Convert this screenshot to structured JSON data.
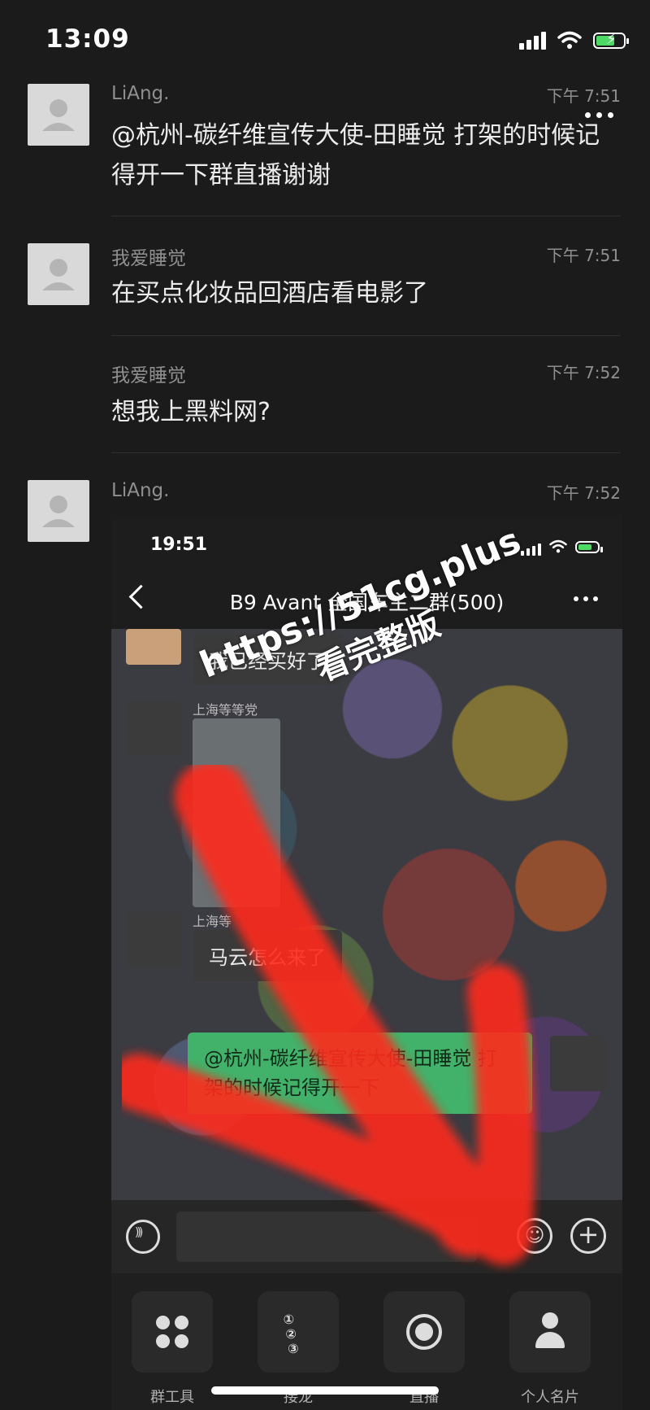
{
  "status_bar": {
    "time": "13:09"
  },
  "messages": [
    {
      "sender": "LiAng.",
      "time": "下午 7:51",
      "text": "@杭州-碳纤维宣传大使-田睡觉 打架的时候记得开一下群直播谢谢"
    },
    {
      "sender": "我爱睡觉",
      "time": "下午 7:51",
      "text": "在买点化妆品回酒店看电影了"
    },
    {
      "sender": "我爱睡觉",
      "time": "下午 7:52",
      "text": "想我上黑料网?"
    },
    {
      "sender": "LiAng.",
      "time": "下午 7:52",
      "text": ""
    }
  ],
  "embedded_screenshot": {
    "time": "19:51",
    "title": "B9 Avant 全国车主二群(500)",
    "chat": [
      {
        "name": "",
        "text": "我已经买好了"
      },
      {
        "name": "上海等等党",
        "text": ""
      },
      {
        "name": "上海等",
        "text": "马云怎么来了"
      },
      {
        "name": "",
        "text": "@杭州-碳纤维宣传大使-田睡觉 打架的时候记得开一下"
      }
    ],
    "tools": [
      {
        "label": "群工具",
        "icon": "group-tools-icon"
      },
      {
        "label": "接龙",
        "icon": "solitaire-icon"
      },
      {
        "label": "直播",
        "icon": "live-icon"
      },
      {
        "label": "个人名片",
        "icon": "contact-card-icon"
      }
    ]
  },
  "watermark": {
    "url": "https://51cg.plus",
    "subtitle": "看完整版"
  },
  "colors": {
    "background": "#1b1b1b",
    "bubble_green": "#42b26a",
    "arrow": "#ff2a1a"
  }
}
